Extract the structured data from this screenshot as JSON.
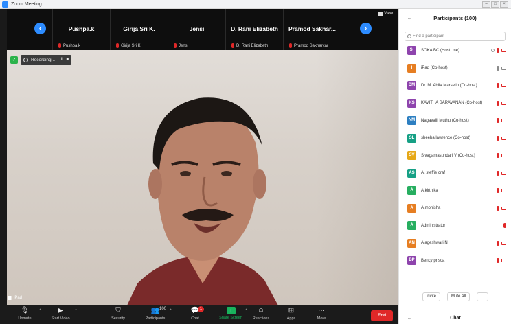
{
  "window": {
    "title": "Zoom Meeting"
  },
  "strip": {
    "tiles": [
      {
        "big": "Pushpa.k",
        "small": "Pushpa.k"
      },
      {
        "big": "Girija Sri K.",
        "small": "Girija Sri K."
      },
      {
        "big": "Jensi",
        "small": "Jensi"
      },
      {
        "big": "D. Rani Elizabeth",
        "small": "D. Rani Elizabeth"
      },
      {
        "big": "Pramod  Sakhar...",
        "small": "Pramod Sakharkar"
      }
    ],
    "view_label": "View"
  },
  "recording": {
    "label": "Recording..."
  },
  "video": {
    "camera_label": "iPad"
  },
  "toolbar": {
    "unmute": "Unmute",
    "start_video": "Start Video",
    "security": "Security",
    "participants": "Participants",
    "participants_count": "100",
    "chat": "Chat",
    "chat_badge": "1",
    "share_screen": "Share Screen",
    "reactions": "Reactions",
    "apps": "Apps",
    "more": "More",
    "end": "End"
  },
  "panel": {
    "title": "Participants (100)",
    "search_placeholder": "Find a participant",
    "participants": [
      {
        "initials": "SI",
        "name": "SOKA BC (Host, me)",
        "color": "#8e44ad"
      },
      {
        "initials": "I",
        "name": "iPad (Co-host)",
        "color": "#e67e22"
      },
      {
        "initials": "DM",
        "name": "Dr. M. Abila Marselin (Co-host)",
        "color": "#8e44ad"
      },
      {
        "initials": "KS",
        "name": "KAVITHA SARAVANAN (Co-host)",
        "color": "#8e44ad"
      },
      {
        "initials": "NM",
        "name": "Nagavalli Muthu (Co-host)",
        "color": "#2d7fc1"
      },
      {
        "initials": "SL",
        "name": "sheeba lawrence (Co-host)",
        "color": "#16a085"
      },
      {
        "initials": "SV",
        "name": "Sivagamasundari V (Co-host)",
        "color": "#e6a817"
      },
      {
        "initials": "AS",
        "name": "A. steffie craf",
        "color": "#16a085"
      },
      {
        "initials": "A",
        "name": "A.kirthika",
        "color": "#27ae60"
      },
      {
        "initials": "A",
        "name": "A.monisha",
        "color": "#e67e22"
      },
      {
        "initials": "A",
        "name": "Administrator",
        "color": "#27ae60"
      },
      {
        "initials": "AN",
        "name": "Alageshwari N",
        "color": "#e67e22"
      },
      {
        "initials": "BP",
        "name": "Bency prisca",
        "color": "#8e44ad"
      }
    ],
    "invite": "Invite",
    "mute_all": "Mute All",
    "more": "...",
    "chat_title": "Chat"
  }
}
